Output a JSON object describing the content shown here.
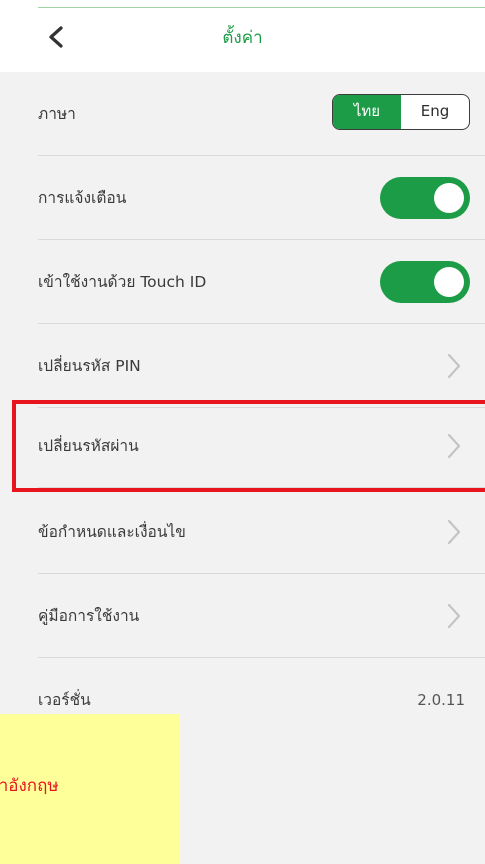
{
  "header": {
    "title": "ตั้งค่า",
    "back_icon": "chevron-left-icon"
  },
  "settings": {
    "language": {
      "label": "ภาษา",
      "options": [
        "ไทย",
        "Eng"
      ],
      "selected": "ไทย"
    },
    "notifications": {
      "label": "การแจ้งเตือน",
      "enabled": true
    },
    "touch_id": {
      "label": "เข้าใช้งานด้วย Touch ID",
      "enabled": true
    },
    "change_pin": {
      "label": "เปลี่ยนรหัส PIN",
      "icon": "chevron-right-icon"
    },
    "change_password": {
      "label": "เปลี่ยนรหัสผ่าน",
      "icon": "chevron-right-icon",
      "highlighted": true
    },
    "terms": {
      "label": "ข้อกำหนดและเงื่อนไข",
      "icon": "chevron-right-icon"
    },
    "manual": {
      "label": "คู่มือการใช้งาน",
      "icon": "chevron-right-icon"
    },
    "version": {
      "label": "เวอร์ชั่น",
      "value": "2.0.11"
    }
  },
  "note": {
    "text": "าษาอังกฤษ"
  },
  "colors": {
    "accent": "#1c9c47",
    "highlight": "#e8141e",
    "note_background": "#ffff99",
    "list_background": "#f2f2f2"
  }
}
